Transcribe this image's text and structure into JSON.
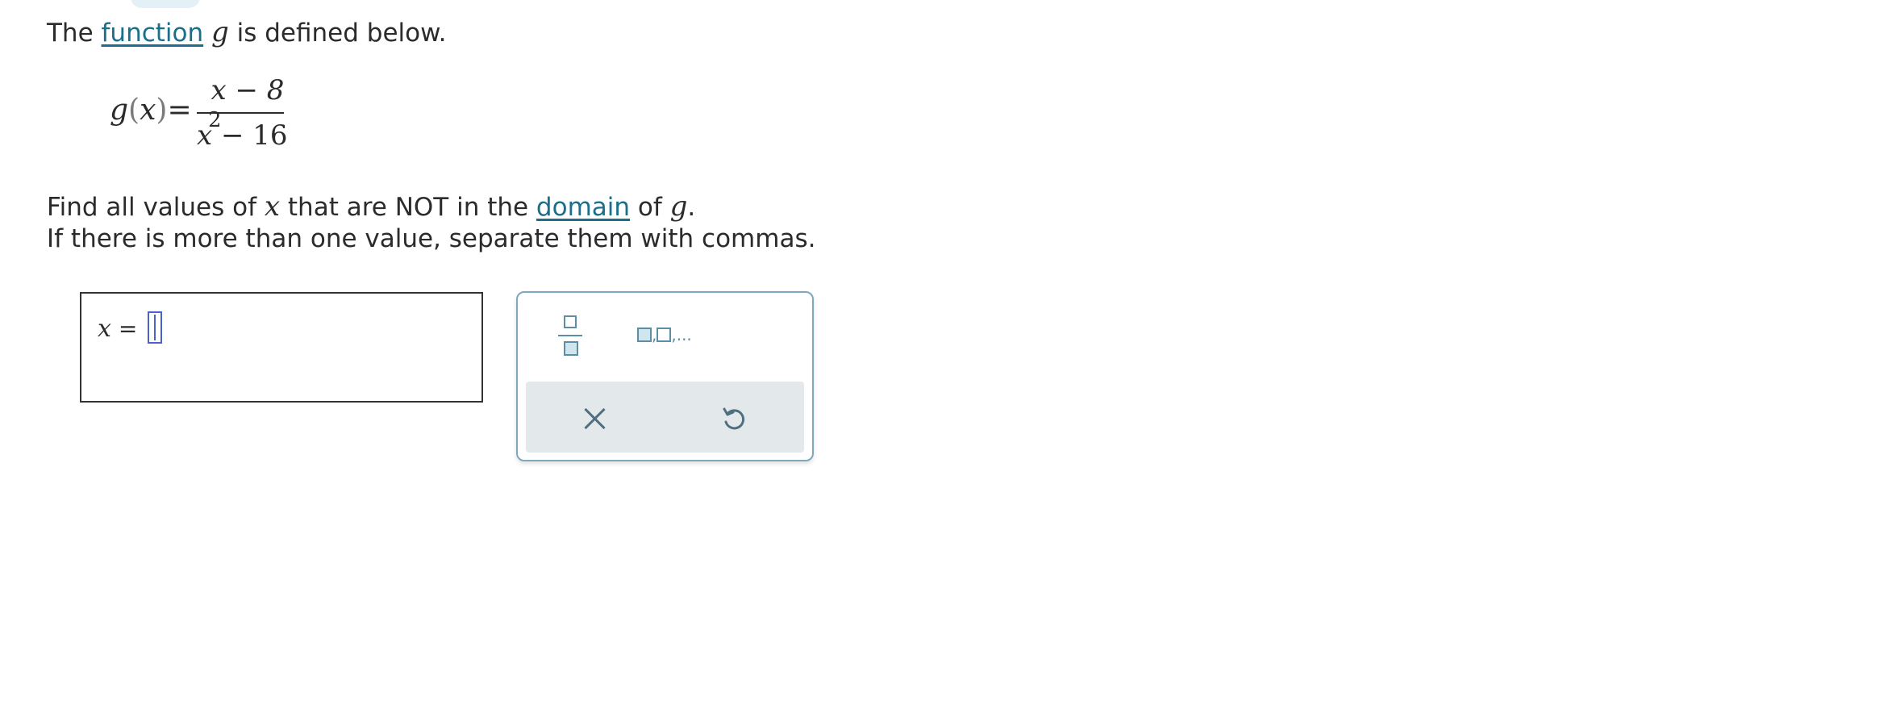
{
  "intro": {
    "prefix": "The ",
    "link": "function",
    "var": "g",
    "suffix": " is defined below."
  },
  "formula": {
    "lhs_fn": "g",
    "lhs_open": "(",
    "lhs_arg": "x",
    "lhs_close": ")",
    "equals": "=",
    "numerator": "x − 8",
    "den_base": "x",
    "den_exp": "2",
    "den_rest": " − 16"
  },
  "question": {
    "prefix": "Find all values of ",
    "var": "x",
    "middle": " that are NOT in the ",
    "link": "domain",
    "of": " of ",
    "var2": "g",
    "end": "."
  },
  "instruction": "If there is more than one value, separate them with commas.",
  "answer": {
    "var": "x",
    "equals": "=",
    "value": ""
  },
  "keypad": {
    "fraction_icon": "fraction-icon",
    "list_icon": "list-icon",
    "list_sep": ",",
    "list_ellipsis": ",...",
    "clear_icon": "close-icon",
    "undo_icon": "undo-icon",
    "accent_color": "#5d8ea6",
    "bottom_bg": "#e3e8ea",
    "link_color": "#1b6f8a"
  }
}
